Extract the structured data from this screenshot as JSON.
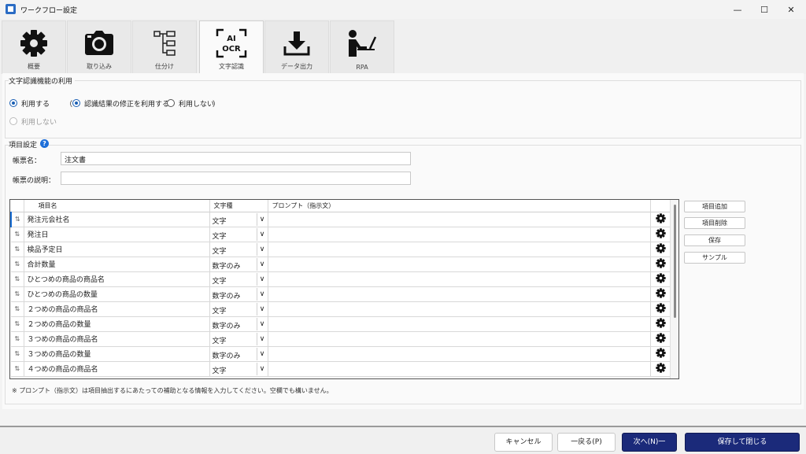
{
  "window": {
    "title": "ワークフロー設定",
    "controls": {
      "minimize": "—",
      "maximize": "☐",
      "close": "✕"
    }
  },
  "tabs": [
    {
      "label": "概要",
      "icon": "gear-icon"
    },
    {
      "label": "取り込み",
      "icon": "camera-icon"
    },
    {
      "label": "仕分け",
      "icon": "tree-icon"
    },
    {
      "label": "文字認識",
      "icon": "ai-ocr-icon",
      "icon_text_top": "AI",
      "icon_text_bottom": "OCR",
      "active": true
    },
    {
      "label": "データ出力",
      "icon": "download-icon"
    },
    {
      "label": "RPA",
      "icon": "robot-operator-icon"
    }
  ],
  "ocr_usage": {
    "title": "文字認識機能の利用",
    "use_label": "利用する",
    "paren_open": "（",
    "paren_close": "）",
    "use_fix_label": "認識結果の修正を利用する",
    "no_fix_label": "利用しない",
    "not_use_label": "利用しない"
  },
  "item_settings": {
    "title": "項目設定",
    "help_glyph": "?",
    "form_name_label": "帳票名：",
    "form_name_value": "注文書",
    "form_desc_label": "帳票の説明：",
    "form_desc_value": ""
  },
  "grid": {
    "headers": {
      "name": "項目名",
      "type": "文字種",
      "prompt": "プロンプト（指示文）"
    },
    "handle_glyph": "⇅",
    "dropdown_glyph": "∨",
    "rows": [
      {
        "name": "発注元会社名",
        "type": "文字",
        "prompt": ""
      },
      {
        "name": "発注日",
        "type": "文字",
        "prompt": ""
      },
      {
        "name": "検品予定日",
        "type": "文字",
        "prompt": ""
      },
      {
        "name": "合計数量",
        "type": "数字のみ",
        "prompt": ""
      },
      {
        "name": "ひとつめの商品の商品名",
        "type": "文字",
        "prompt": ""
      },
      {
        "name": "ひとつめの商品の数量",
        "type": "数字のみ",
        "prompt": ""
      },
      {
        "name": "２つめの商品の商品名",
        "type": "文字",
        "prompt": ""
      },
      {
        "name": "２つめの商品の数量",
        "type": "数字のみ",
        "prompt": ""
      },
      {
        "name": "３つめの商品の商品名",
        "type": "文字",
        "prompt": ""
      },
      {
        "name": "３つめの商品の数量",
        "type": "数字のみ",
        "prompt": ""
      },
      {
        "name": "４つめの商品の商品名",
        "type": "文字",
        "prompt": ""
      }
    ]
  },
  "side_buttons": {
    "add": "項目追加",
    "delete": "項目削除",
    "save": "保存",
    "sample": "サンプル"
  },
  "note": "※ プロンプト（指示文）は項目抽出するにあたっての補助となる情報を入力してください。空欄でも構いません。",
  "footer": {
    "cancel": "キャンセル",
    "back": "一戻る(P)",
    "next": "次へ(N)一",
    "save_close": "保存して閉じる"
  },
  "colors": {
    "accent": "#1a5fb4",
    "primary_button": "#1b2a7a"
  }
}
